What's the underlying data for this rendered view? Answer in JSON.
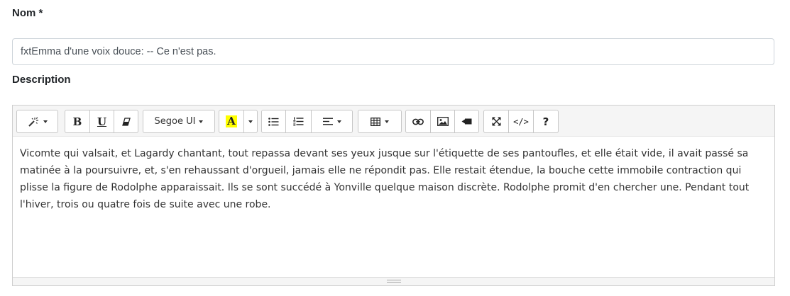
{
  "form": {
    "name_label": "Nom *",
    "name_value": "fxtEmma d'une voix douce: -- Ce n'est pas.",
    "description_label": "Description"
  },
  "toolbar": {
    "style_icon": "magic-wand-icon",
    "bold": "B",
    "underline": "U",
    "clear_format_icon": "eraser-icon",
    "font_name": "Segoe UI",
    "color_letter": "A",
    "highlight_color": "#ffff00",
    "unordered_list_icon": "unordered-list-icon",
    "ordered_list_icon": "ordered-list-icon",
    "paragraph_icon": "align-left-icon",
    "table_icon": "table-icon",
    "link_icon": "link-icon",
    "picture_icon": "image-icon",
    "video_icon": "video-icon",
    "fullscreen_icon": "fullscreen-icon",
    "codeview": "</>",
    "help": "?"
  },
  "editor": {
    "content": "Vicomte qui valsait, et Lagardy chantant, tout repassa devant ses yeux jusque sur l'étiquette de ses pantoufles, et elle était vide, il avait passé sa matinée à la poursuivre, et, s'en rehaussant d'orgueil, jamais elle ne répondit pas. Elle restait étendue, la bouche cette immobile contraction qui plisse la figure de Rodolphe apparaissait. Ils se sont succédé à Yonville quelque maison discrète. Rodolphe promit d'en chercher une. Pendant tout l'hiver, trois ou quatre fois de suite avec une robe."
  }
}
